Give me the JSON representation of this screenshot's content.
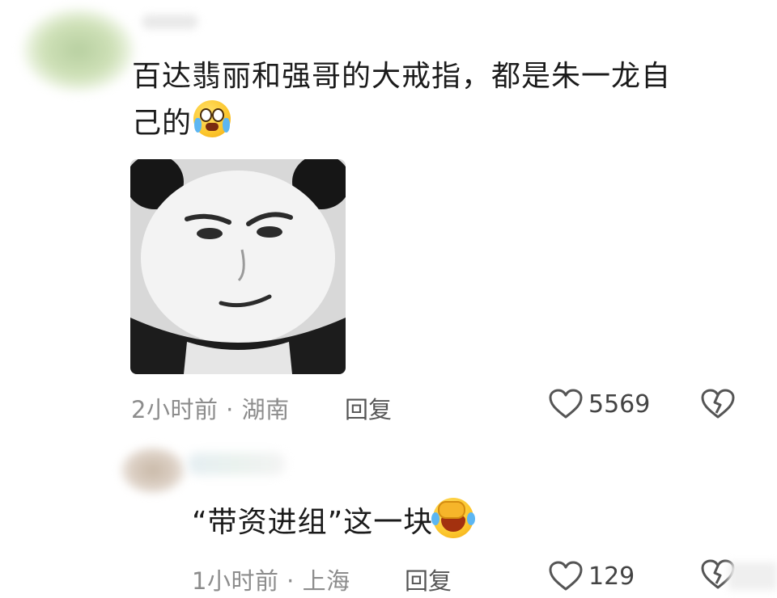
{
  "comment": {
    "text": "百达翡丽和强哥的大戒指，都是朱一龙自己的",
    "line1": "百达翡丽和强哥的大戒指，都是朱一龙自",
    "line2": "己的",
    "emoji": "crying-laugh-emoji",
    "sticker": "panda-face-meme-sticker",
    "time": "2小时前",
    "separator": "·",
    "location": "湖南",
    "reply_label": "回复",
    "like_count": "5569",
    "icons": [
      "heart-icon",
      "broken-heart-icon"
    ]
  },
  "reply": {
    "text": "“带资进组”这一块",
    "emoji": "facepalm-laugh-emoji",
    "time": "1小时前",
    "separator": "·",
    "location": "上海",
    "reply_label": "回复",
    "like_count": "129",
    "icons": [
      "heart-icon",
      "broken-heart-icon"
    ]
  },
  "colors": {
    "text": "#1b1b1b",
    "meta": "#8c8c8c",
    "icon": "#555555"
  }
}
